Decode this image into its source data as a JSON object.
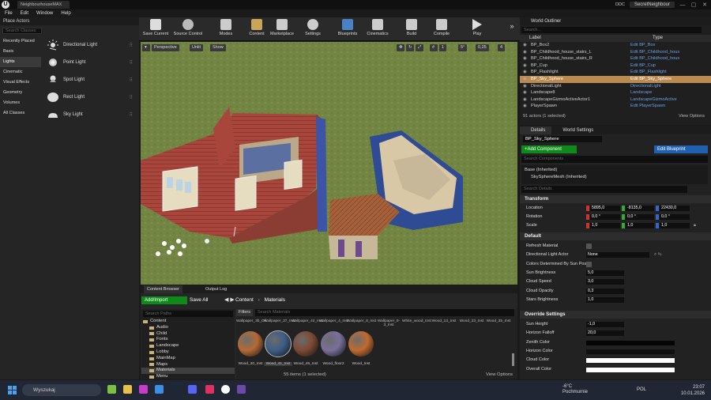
{
  "window": {
    "tab_title": "NeighbourhouseMAX",
    "project": "SecretNeighbour",
    "ddc": "DDC",
    "min": "—",
    "max": "▢",
    "close": "✕"
  },
  "menu": [
    "File",
    "Edit",
    "Window",
    "Help"
  ],
  "place_actors": {
    "title": "Place Actors",
    "search_placeholder": "Search Classes",
    "categories": [
      "Recently Placed",
      "Basic",
      "Lights",
      "Cinematic",
      "Visual Effects",
      "Geometry",
      "Volumes",
      "All Classes"
    ],
    "items": [
      "Directional Light",
      "Point Light",
      "Spot Light",
      "Rect Light",
      "Sky Light"
    ]
  },
  "toolbar": [
    "Save Current",
    "Source Control",
    "Modes",
    "Content",
    "Marketplace",
    "Settings",
    "Blueprints",
    "Cinematics",
    "Build",
    "Compile",
    "Play"
  ],
  "viewport": {
    "perspective": "Perspective",
    "unlit": "Unlit",
    "show": "Show",
    "grid_snap": "1",
    "rot_snap": "5°",
    "scale_snap": "0,25",
    "cam_speed": "4"
  },
  "content_browser": {
    "tab1": "Content Browser",
    "tab2": "Output Log",
    "add_import": "Add/Import",
    "save_all": "Save All",
    "path_root": "Content",
    "path_leaf": "Materials",
    "folder_search": "Search Paths",
    "folders": [
      "Content",
      "Audio",
      "Child",
      "Fonts",
      "Landscape",
      "Lobby",
      "MainMap",
      "Maps",
      "Materials",
      "Menu"
    ],
    "filters": "Filters",
    "search_placeholder": "Search Materials",
    "top_row": [
      "Wallpaper_3b_Dif",
      "Wallpaper_37_Inst",
      "Wallpaper_42_Inst",
      "Wallpaper_4_Inst",
      "Wallpaper_8_Inst",
      "Wallpaper_9-3_Inst",
      "White_wood_Inst",
      "Wood_13_Inst",
      "Wood_33_Inst",
      "Wood_35_Inst"
    ],
    "thumbs": [
      {
        "label": "Wood_30_Inst",
        "color": "#b56a35"
      },
      {
        "label": "Wood_41_Inst",
        "color": "#3e5d86"
      },
      {
        "label": "Wood_49_Inst",
        "color": "#7d4a34"
      },
      {
        "label": "Wood_floor2",
        "color": "#7a6f9a"
      },
      {
        "label": "Wood_Inst",
        "color": "#c06a30"
      }
    ],
    "status": "55 items (1 selected)",
    "view_options": "View Options"
  },
  "outliner": {
    "title": "World Outliner",
    "search_placeholder": "Search...",
    "col_label": "Label",
    "col_type": "Type",
    "rows": [
      {
        "label": "BP_Box2",
        "type": "Edit BP_Box"
      },
      {
        "label": "BP_Childhood_house_stairs_L",
        "type": "Edit BP_Childhood_hous"
      },
      {
        "label": "BP_Childhood_house_stairs_R",
        "type": "Edit BP_Childhood_hous"
      },
      {
        "label": "BP_Cup",
        "type": "Edit BP_Cup"
      },
      {
        "label": "BP_Flashlight",
        "type": "Edit BP_Flashlight"
      },
      {
        "label": "BP_Sky_Sphere",
        "type": "Edit BP_Sky_Sphere"
      },
      {
        "label": "DirectionalLight",
        "type": "DirectionalLight"
      },
      {
        "label": "Landscape8",
        "type": "Landscape"
      },
      {
        "label": "LandscapeGizmoActiveActor1",
        "type": "LandscapeGizmoActive"
      },
      {
        "label": "PlayerSpawn",
        "type": "Edit PlayerSpawn"
      }
    ],
    "selected_index": 5,
    "count": "91 actors (1 selected)",
    "view_options": "View Options"
  },
  "details": {
    "tab1": "Details",
    "tab2": "World Settings",
    "actor_name": "BP_Sky_Sphere",
    "add_component": "+Add Component",
    "edit_blueprint": "Edit Blueprint",
    "search_components": "Search Components",
    "comp_base": "Base (Inherited)",
    "comp_mesh": "SkySphereMesh (Inherited)",
    "search_details": "Search Details",
    "transform": "Transform",
    "location_label": "Location",
    "location": [
      "5895,0",
      "-8135,0",
      "22430,0"
    ],
    "rotation_label": "Rotation",
    "rotation": [
      "0,0 °",
      "0,0 °",
      "0,0 °"
    ],
    "scale_label": "Scale",
    "scale": [
      "1,0",
      "1,0",
      "1,0"
    ],
    "default": "Default",
    "refresh_material": "Refresh Material",
    "dir_light_actor": "Directional Light Actor",
    "dir_light_value": "None",
    "colors_by_sun": "Colors Determined By Sun Posit",
    "sun_brightness": "Sun Brightness",
    "sun_brightness_value": "5,0",
    "cloud_speed": "Cloud Speed",
    "cloud_speed_value": "3,0",
    "cloud_opacity": "Cloud Opacity",
    "cloud_opacity_value": "0,3",
    "stars_brightness": "Stars Brightness",
    "stars_brightness_value": "1,0",
    "override": "Override Settings",
    "sun_height": "Sun Height",
    "sun_height_value": "-1,0",
    "horizon_falloff": "Horizon Falloff",
    "horizon_falloff_value": "20,0",
    "zenith_color": "Zenith Color",
    "horizon_color": "Horizon Color",
    "cloud_color": "Cloud Color",
    "overall_color": "Overall Color"
  },
  "taskbar": {
    "search": "Wyszukaj",
    "weather": "-6°C",
    "weather_desc": "Pochmurnie",
    "lang": "POL",
    "time": "23:07",
    "date": "10.01.2026"
  }
}
